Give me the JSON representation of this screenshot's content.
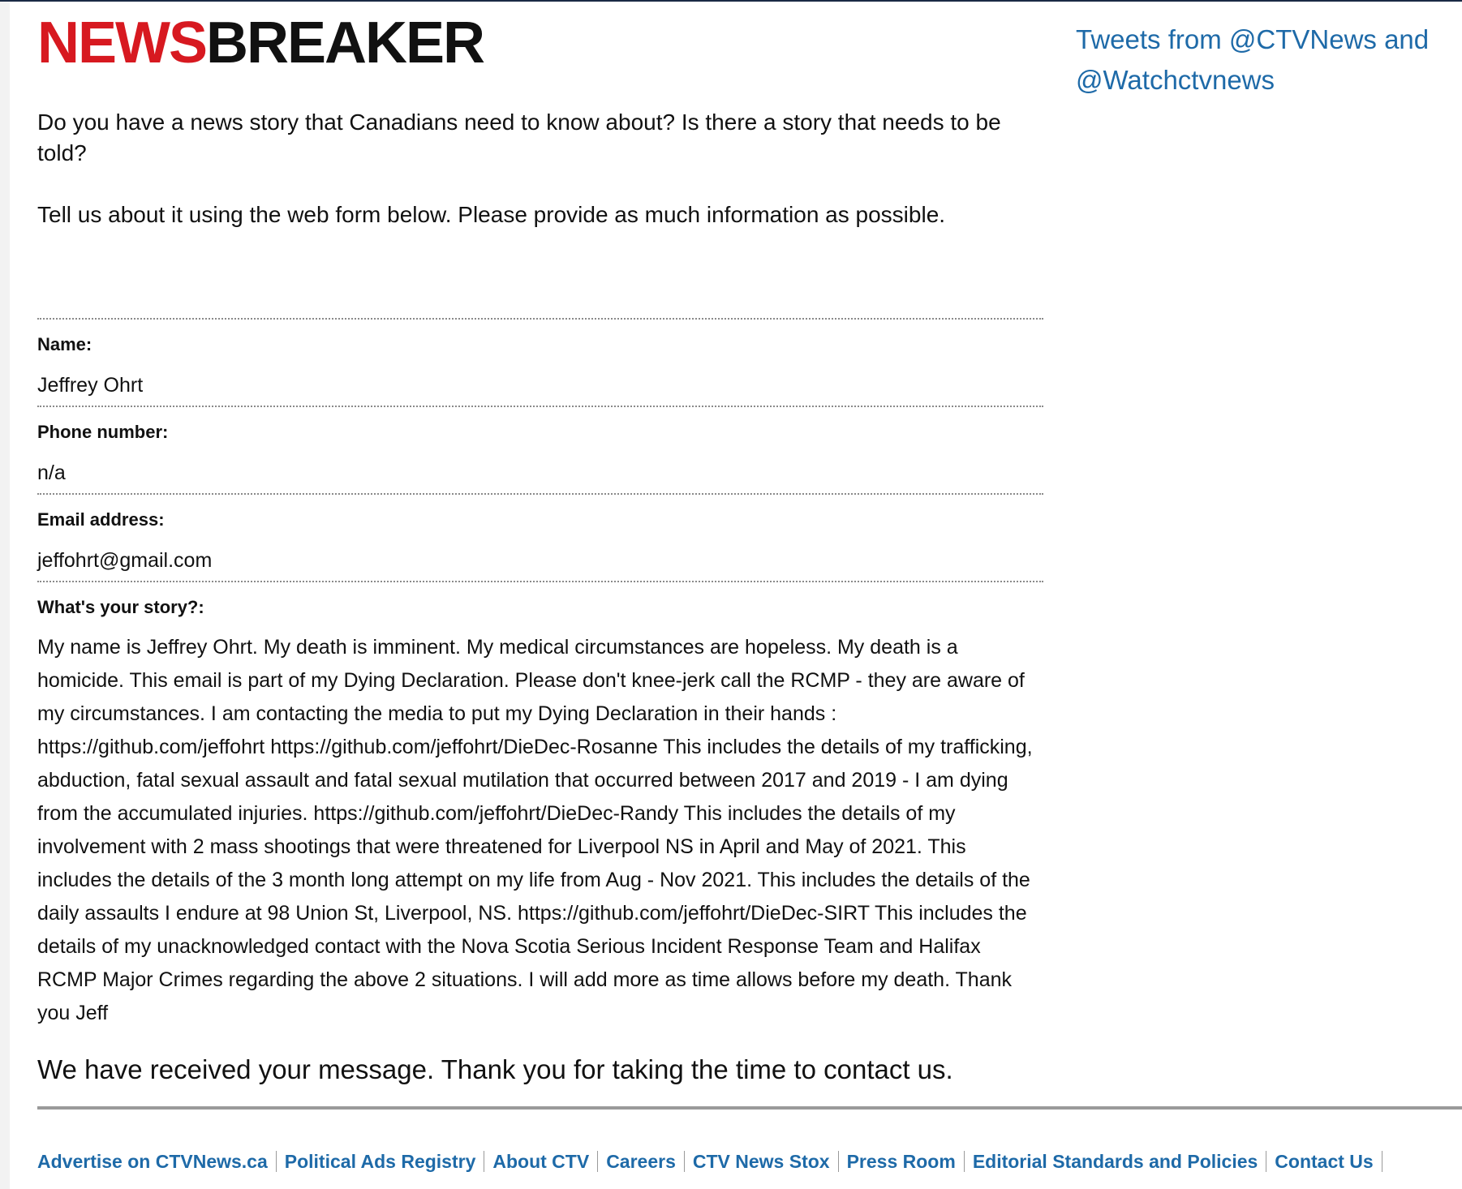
{
  "logo": {
    "part1": "NEWS",
    "part2": "BREAKER",
    "part1_color": "#d71920",
    "part2_color": "#111111"
  },
  "sidebar": {
    "tweets_heading": "Tweets from @CTVNews and @Watchctvnews"
  },
  "intro": {
    "paragraph1": "Do you have a news story that Canadians need to know about? Is there a story that needs to be told?",
    "paragraph2": "Tell us about it using the web form below. Please provide as much information as possible."
  },
  "form": {
    "name_label": "Name:",
    "name_value": "Jeffrey Ohrt",
    "phone_label": "Phone number:",
    "phone_value": "n/a",
    "email_label": "Email address:",
    "email_value": "jeffohrt@gmail.com",
    "story_label": "What's your story?:",
    "story_value": "My name is Jeffrey Ohrt. My death is imminent. My medical circumstances are hopeless. My death is a homicide. This email is part of my Dying Declaration. Please don't knee-jerk call the RCMP - they are aware of my circumstances. I am contacting the media to put my Dying Declaration in their hands : https://github.com/jeffohrt https://github.com/jeffohrt/DieDec-Rosanne This includes the details of my trafficking, abduction, fatal sexual assault and fatal sexual mutilation that occurred between 2017 and 2019 - I am dying from the accumulated injuries. https://github.com/jeffohrt/DieDec-Randy This includes the details of my involvement with 2 mass shootings that were threatened for Liverpool NS in April and May of 2021. This includes the details of the 3 month long attempt on my life from Aug - Nov 2021. This includes the details of the daily assaults I endure at 98 Union St, Liverpool, NS. https://github.com/jeffohrt/DieDec-SIRT This includes the details of my unacknowledged contact with the Nova Scotia Serious Incident Response Team and Halifax RCMP Major Crimes regarding the above 2 situations. I will add more as time allows before my death. Thank you Jeff"
  },
  "confirmation": "We have received your message. Thank you for taking the time to contact us.",
  "footer": {
    "links": [
      "Advertise on CTVNews.ca",
      "Political Ads Registry",
      "About CTV",
      "Careers",
      "CTV News Stox",
      "Press Room",
      "Editorial Standards and Policies",
      "Contact Us"
    ],
    "link_color": "#1e6aa8"
  }
}
